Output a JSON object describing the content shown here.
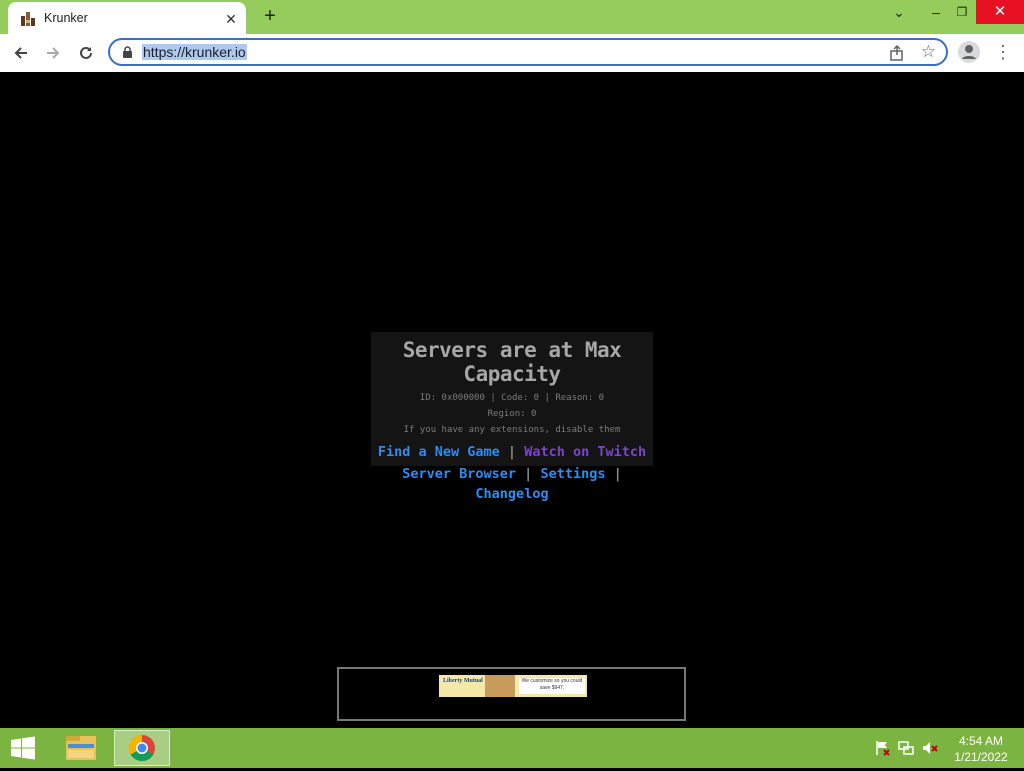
{
  "browser": {
    "tab_title": "Krunker",
    "tab_close": "✕",
    "new_tab": "+",
    "url": "https://krunker.io",
    "icons": {
      "favicon": "krunker-favicon",
      "back": "back-arrow-icon",
      "forward": "forward-arrow-icon",
      "reload": "reload-icon",
      "lock": "lock-icon",
      "share": "share-icon",
      "bookmark": "star-icon",
      "profile": "profile-icon",
      "menu": "kebab-menu-icon"
    },
    "window_controls": {
      "tab_search": "⌄",
      "minimize": "–",
      "restore": "❐",
      "close": "✕"
    }
  },
  "game": {
    "heading": "Servers are at Max Capacity",
    "info_line": "ID: 0x000000 | Code: 0 | Reason: 0",
    "region_line": "Region: 0",
    "extensions_line": "If you have any extensions, disable them",
    "links": {
      "find_new_game": "Find a New Game",
      "watch_twitch": "Watch on Twitch",
      "server_browser": "Server Browser",
      "settings": "Settings",
      "changelog": "Changelog",
      "separator": "|"
    },
    "ad": {
      "brand": "Liberty Mutual",
      "tagline": "We customize so you could save $947."
    },
    "colors": {
      "link_blue": "#2f8cf0",
      "twitch_purple": "#7b45cc",
      "panel_bg": "#141414"
    }
  },
  "taskbar": {
    "time": "4:54 AM",
    "date": "1/21/2022",
    "pinned": [
      "file-explorer-icon",
      "chrome-icon"
    ],
    "tray": [
      "action-center-flag-icon",
      "network-icon",
      "volume-muted-icon"
    ]
  }
}
